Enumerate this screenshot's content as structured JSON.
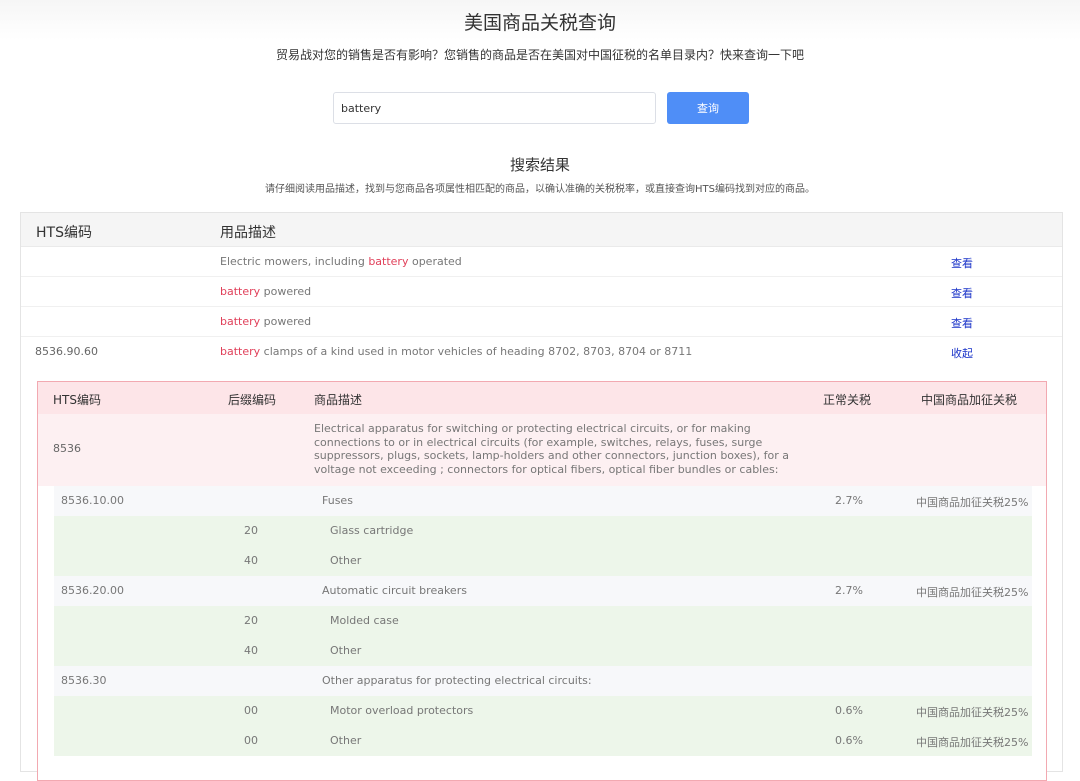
{
  "header": {
    "title": "美国商品关税查询",
    "subtitle": "贸易战对您的销售是否有影响？您销售的商品是否在美国对中国征税的名单目录内？快来查询一下吧"
  },
  "search": {
    "value": "battery",
    "button_label": "查询"
  },
  "results": {
    "title": "搜索结果",
    "hint": "请仔细阅读用品描述，找到与您商品各项属性相匹配的商品，以确认准确的关税税率，或直接查询HTS编码找到对应的商品。",
    "columns": {
      "code": "HTS编码",
      "desc": "用品描述"
    },
    "rows": [
      {
        "code": "",
        "pre": "Electric mowers, including ",
        "hl": "battery",
        "post": " operated",
        "action": "查看"
      },
      {
        "code": "",
        "pre": "",
        "hl": "battery",
        "post": " powered",
        "action": "查看"
      },
      {
        "code": "",
        "pre": "",
        "hl": "battery",
        "post": " powered",
        "action": "查看"
      },
      {
        "code": "8536.90.60",
        "pre": "",
        "hl": "battery",
        "post": " clamps of a kind used in motor vehicles of heading 8702, 8703, 8704 or 8711",
        "action": "收起"
      }
    ]
  },
  "detail": {
    "columns": {
      "code": "HTS编码",
      "suffix": "后缀编码",
      "desc": "商品描述",
      "normal": "正常关税",
      "extra": "中国商品加征关税"
    },
    "main": {
      "code": "8536",
      "desc": "Electrical apparatus for switching or protecting electrical circuits, or for making connections to or in electrical circuits (for example, switches, relays, fuses, surge suppressors, plugs, sockets, lamp-holders and other connectors, junction boxes), for a voltage not exceeding ; connectors for optical fibers, optical fiber bundles or cables:"
    },
    "rows": [
      {
        "type": "sub",
        "code": "8536.10.00",
        "suffix": "",
        "desc": "Fuses",
        "normal": "2.7%",
        "extra": "中国商品加征关税25%"
      },
      {
        "type": "leaf",
        "code": "",
        "suffix": "20",
        "desc": "Glass cartridge",
        "normal": "",
        "extra": ""
      },
      {
        "type": "leaf",
        "code": "",
        "suffix": "40",
        "desc": "Other",
        "normal": "",
        "extra": ""
      },
      {
        "type": "sub",
        "code": "8536.20.00",
        "suffix": "",
        "desc": "Automatic circuit breakers",
        "normal": "2.7%",
        "extra": "中国商品加征关税25%"
      },
      {
        "type": "leaf",
        "code": "",
        "suffix": "20",
        "desc": "Molded case",
        "normal": "",
        "extra": ""
      },
      {
        "type": "leaf",
        "code": "",
        "suffix": "40",
        "desc": "Other",
        "normal": "",
        "extra": ""
      },
      {
        "type": "sub",
        "code": "8536.30",
        "suffix": "",
        "desc": "Other apparatus for protecting electrical circuits:",
        "normal": "",
        "extra": ""
      },
      {
        "type": "leaf",
        "code": "",
        "suffix": "00",
        "desc": "Motor overload protectors",
        "normal": "0.6%",
        "extra": "中国商品加征关税25%"
      },
      {
        "type": "leaf",
        "code": "",
        "suffix": "00",
        "desc": "Other",
        "normal": "0.6%",
        "extra": "中国商品加征关税25%"
      }
    ]
  }
}
